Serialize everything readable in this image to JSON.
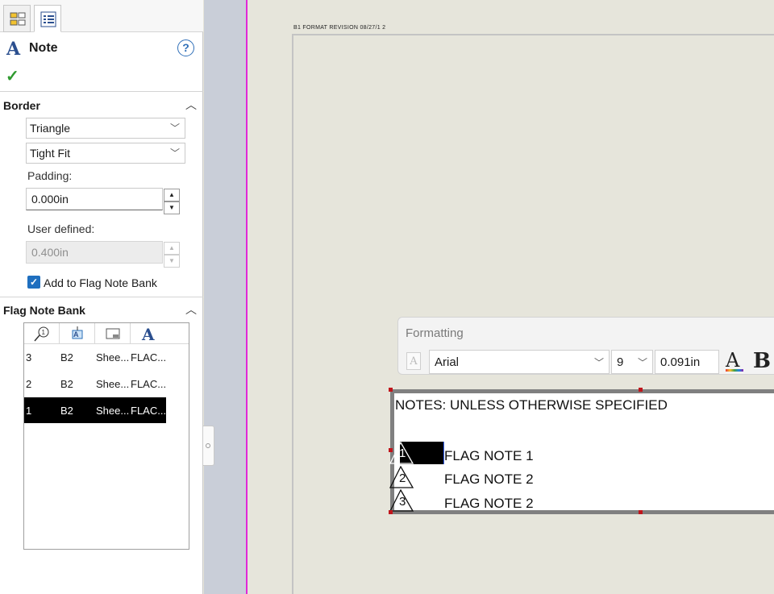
{
  "panel": {
    "title": "Note",
    "help_glyph": "?",
    "ok_glyph": "✓",
    "border_group": {
      "title": "Border",
      "shape_value": "Triangle",
      "size_value": "Tight Fit",
      "padding_label": "Padding:",
      "padding_value": "0.000in",
      "user_defined_label": "User defined:",
      "user_defined_value": "0.400in",
      "add_to_bank_label": "Add to Flag Note Bank",
      "add_to_bank_checked": true
    },
    "bank_group": {
      "title": "Flag Note Bank",
      "rows": [
        {
          "num": "3",
          "zone": "B2",
          "sheet": "Shee...",
          "text": "FLAC..."
        },
        {
          "num": "2",
          "zone": "B2",
          "sheet": "Shee...",
          "text": "FLAC..."
        },
        {
          "num": "1",
          "zone": "B2",
          "sheet": "Shee...",
          "text": "FLAC..."
        }
      ],
      "selected_row": "1"
    }
  },
  "sheet": {
    "format_revision": "B1 FORMAT REVISION 08/27/1 2"
  },
  "formatting": {
    "title": "Formatting",
    "font": "Arial",
    "size": "9",
    "height": "0.091in",
    "color_glyph": "A",
    "bold_glyph": "B"
  },
  "note": {
    "heading": "NOTES: UNLESS OTHERWISE SPECIFIED",
    "flags": [
      {
        "num": "1",
        "text": "FLAG NOTE 1"
      },
      {
        "num": "2",
        "text": "FLAG NOTE 2"
      },
      {
        "num": "3",
        "text": "FLAG NOTE 2"
      }
    ]
  },
  "colors": {
    "accent": "#1f6fbf",
    "highlight": "#e028d8",
    "selection": "#000000",
    "handle": "#c0161c"
  }
}
